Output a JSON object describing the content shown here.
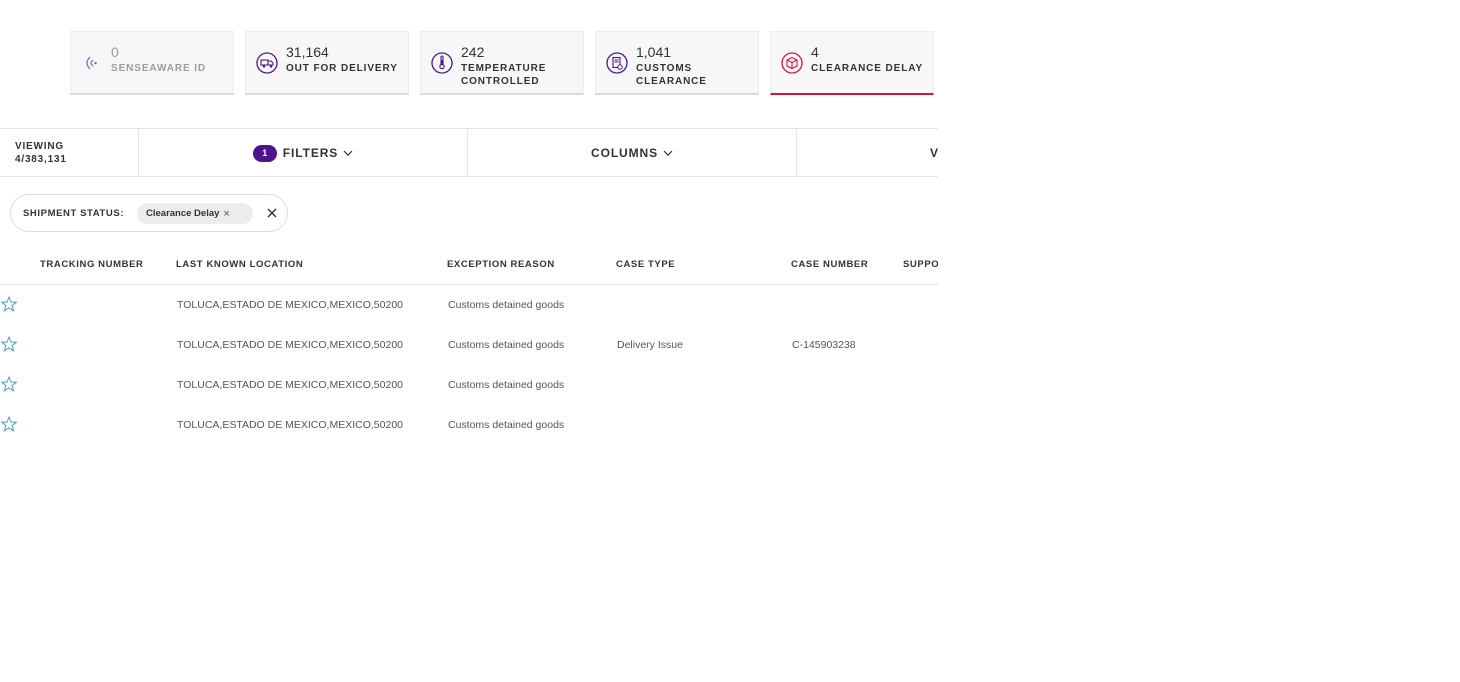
{
  "colors": {
    "accent_purple": "#4d148c",
    "active_red": "#d8143a",
    "star_teal": "#4a9fb5"
  },
  "stat_cards": [
    {
      "icon": "senseaware-signal-icon",
      "value": "0",
      "label_lines": [
        "SENSEAWARE ID"
      ],
      "dimmed": true,
      "active": false
    },
    {
      "icon": "delivery-truck-icon",
      "value": "31,164",
      "label_lines": [
        "OUT FOR DELIVERY"
      ],
      "dimmed": false,
      "active": false
    },
    {
      "icon": "thermometer-icon",
      "value": "242",
      "label_lines": [
        "TEMPERATURE",
        "CONTROLLED"
      ],
      "dimmed": false,
      "active": false
    },
    {
      "icon": "customs-document-icon",
      "value": "1,041",
      "label_lines": [
        "CUSTOMS",
        "CLEARANCE"
      ],
      "dimmed": false,
      "active": false
    },
    {
      "icon": "package-alert-icon",
      "value": "4",
      "label_lines": [
        "CLEARANCE DELAY"
      ],
      "dimmed": false,
      "active": true
    }
  ],
  "toolbar": {
    "viewing_label": "VIEWING",
    "viewing_count": "4/383,131",
    "filters_badge": "1",
    "filters_label": "FILTERS",
    "columns_label": "COLUMNS",
    "third_label_partial": "V"
  },
  "active_filter": {
    "label": "SHIPMENT STATUS:",
    "chip_label": "Clearance Delay",
    "chip_remove_glyph": "×"
  },
  "table": {
    "headers": [
      "TRACKING NUMBER",
      "LAST KNOWN LOCATION",
      "EXCEPTION REASON",
      "CASE TYPE",
      "CASE NUMBER",
      "SUPPO"
    ],
    "rows": [
      {
        "tracking": "",
        "location": "TOLUCA,ESTADO DE MEXICO,MEXICO,50200",
        "reason": "Customs detained goods",
        "case_type": "",
        "case_number": ""
      },
      {
        "tracking": "",
        "location": "TOLUCA,ESTADO DE MEXICO,MEXICO,50200",
        "reason": "Customs detained goods",
        "case_type": "Delivery Issue",
        "case_number": "C-145903238"
      },
      {
        "tracking": "",
        "location": "TOLUCA,ESTADO DE MEXICO,MEXICO,50200",
        "reason": "Customs detained goods",
        "case_type": "",
        "case_number": ""
      },
      {
        "tracking": "",
        "location": "TOLUCA,ESTADO DE MEXICO,MEXICO,50200",
        "reason": "Customs detained goods",
        "case_type": "",
        "case_number": ""
      }
    ]
  }
}
